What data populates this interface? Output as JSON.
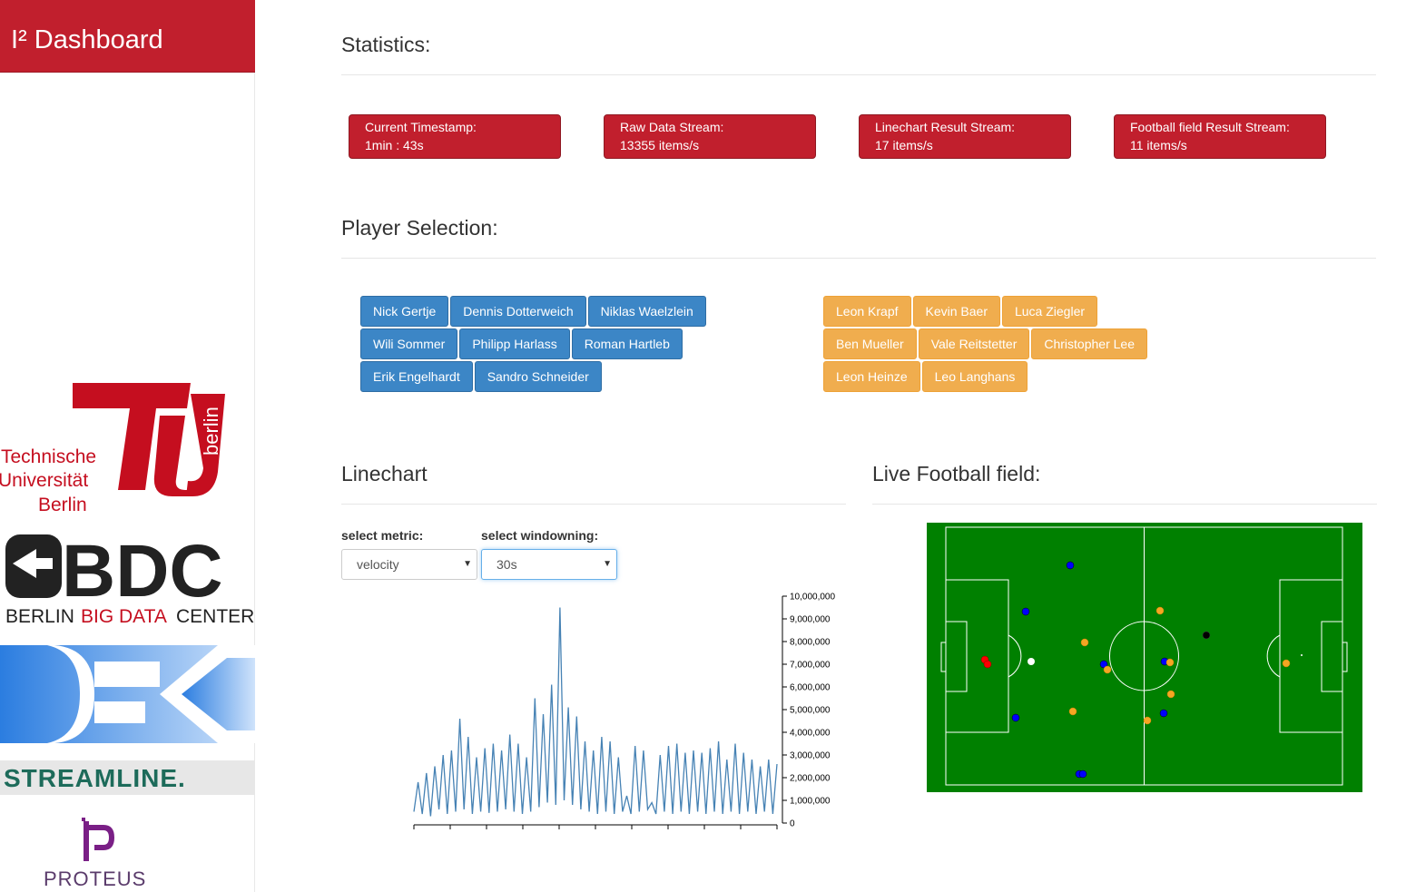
{
  "brand": {
    "title": "I² Dashboard"
  },
  "logos": {
    "tu": {
      "line1": "Technische",
      "line2": "Universität",
      "line3": "Berlin",
      "side": "berlin"
    },
    "bbdc": {
      "main": "BDC",
      "left": "BERLIN",
      "mid": "BIG DATA",
      "right": "CENTER"
    },
    "streamline": "STREAMLINE.",
    "proteus": "PROTEUS"
  },
  "statistics": {
    "title": "Statistics:",
    "boxes": [
      {
        "label": "Current Timestamp:",
        "value": "1min : 43s"
      },
      {
        "label": "Raw Data Stream:",
        "value": "13355 items/s"
      },
      {
        "label": "Linechart Result Stream:",
        "value": "17 items/s"
      },
      {
        "label": "Football field Result Stream:",
        "value": "11 items/s"
      }
    ]
  },
  "players": {
    "title": "Player Selection:",
    "blue": [
      "Nick Gertje",
      "Dennis Dotterweich",
      "Niklas Waelzlein",
      "Wili Sommer",
      "Philipp Harlass",
      "Roman Hartleb",
      "Erik Engelhardt",
      "Sandro Schneider"
    ],
    "orange": [
      "Leon Krapf",
      "Kevin Baer",
      "Luca Ziegler",
      "Ben Mueller",
      "Vale Reitstetter",
      "Christopher Lee",
      "Leon Heinze",
      "Leo Langhans"
    ]
  },
  "linechart": {
    "title": "Linechart",
    "metric_label": "select metric:",
    "metric_value": "velocity",
    "window_label": "select windowning:",
    "window_value": "30s"
  },
  "field": {
    "title": "Live Football field:"
  },
  "colors": {
    "brand": "#c11f2d",
    "blue": "#3c86c6",
    "orange": "#f0ad4e",
    "pitch": "#008000",
    "line": "#4682b4"
  },
  "chart_data": {
    "type": "line",
    "title": "",
    "xlabel": "",
    "ylabel": "",
    "ylim": [
      0,
      10000000
    ],
    "y_ticks": [
      "0",
      "1,000,000",
      "2,000,000",
      "3,000,000",
      "4,000,000",
      "5,000,000",
      "6,000,000",
      "7,000,000",
      "8,000,000",
      "9,000,000",
      "10,000,000"
    ],
    "series": [
      {
        "values": [
          500000,
          1800000,
          400000,
          2200000,
          300000,
          2500000,
          600000,
          3000000,
          400000,
          3200000,
          500000,
          4600000,
          600000,
          3800000,
          400000,
          2900000,
          500000,
          3300000,
          450000,
          3500000,
          500000,
          3200000,
          600000,
          3900000,
          500000,
          3500000,
          400000,
          2900000,
          500000,
          5500000,
          700000,
          4800000,
          900000,
          6100000,
          800000,
          9500000,
          1000000,
          5100000,
          800000,
          4700000,
          600000,
          3600000,
          500000,
          3200000,
          400000,
          3800000,
          500000,
          3600000,
          400000,
          2900000,
          500000,
          1200000,
          400000,
          3400000,
          500000,
          3200000,
          600000,
          900000,
          400000,
          3000000,
          500000,
          3400000,
          400000,
          3500000,
          500000,
          3100000,
          400000,
          3200000,
          500000,
          3100000,
          400000,
          3300000,
          500000,
          3600000,
          400000,
          2800000,
          500000,
          3500000,
          400000,
          3100000,
          500000,
          2800000,
          400000,
          2500000,
          500000,
          2800000,
          400000,
          2600000
        ]
      }
    ]
  }
}
